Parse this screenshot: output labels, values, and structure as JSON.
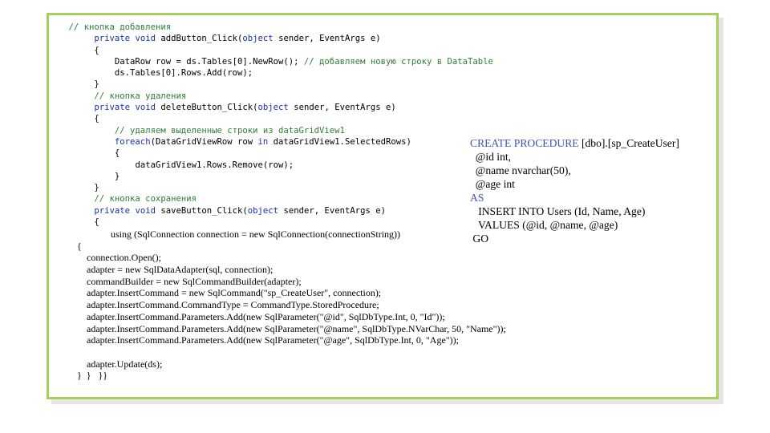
{
  "code_lines": [
    {
      "indent": "    ",
      "parts": [
        {
          "t": "// кнопка добавления",
          "c": "comment"
        }
      ]
    },
    {
      "indent": "         ",
      "parts": [
        {
          "t": "private",
          "c": "kw"
        },
        {
          "t": " ",
          "c": ""
        },
        {
          "t": "void",
          "c": "kw"
        },
        {
          "t": " addButton_Click(",
          "c": ""
        },
        {
          "t": "object",
          "c": "kw"
        },
        {
          "t": " sender, EventArgs e)",
          "c": ""
        }
      ]
    },
    {
      "indent": "         ",
      "parts": [
        {
          "t": "{",
          "c": ""
        }
      ]
    },
    {
      "indent": "             ",
      "parts": [
        {
          "t": "DataRow row = ds.Tables[0].NewRow(); ",
          "c": ""
        },
        {
          "t": "// добавляем новую строку в DataTable",
          "c": "comment"
        }
      ]
    },
    {
      "indent": "             ",
      "parts": [
        {
          "t": "ds.Tables[0].Rows.Add(row);",
          "c": ""
        }
      ]
    },
    {
      "indent": "         ",
      "parts": [
        {
          "t": "}",
          "c": ""
        }
      ]
    },
    {
      "indent": "         ",
      "parts": [
        {
          "t": "// кнопка удаления",
          "c": "comment"
        }
      ]
    },
    {
      "indent": "         ",
      "parts": [
        {
          "t": "private",
          "c": "kw"
        },
        {
          "t": " ",
          "c": ""
        },
        {
          "t": "void",
          "c": "kw"
        },
        {
          "t": " deleteButton_Click(",
          "c": ""
        },
        {
          "t": "object",
          "c": "kw"
        },
        {
          "t": " sender, EventArgs e)",
          "c": ""
        }
      ]
    },
    {
      "indent": "         ",
      "parts": [
        {
          "t": "{",
          "c": ""
        }
      ]
    },
    {
      "indent": "             ",
      "parts": [
        {
          "t": "// удаляем выделенные строки из dataGridView1",
          "c": "comment"
        }
      ]
    },
    {
      "indent": "             ",
      "parts": [
        {
          "t": "foreach",
          "c": "kw"
        },
        {
          "t": "(DataGridViewRow row ",
          "c": ""
        },
        {
          "t": "in",
          "c": "kw"
        },
        {
          "t": " dataGridView1.SelectedRows)",
          "c": ""
        }
      ]
    },
    {
      "indent": "             ",
      "parts": [
        {
          "t": "{",
          "c": ""
        }
      ]
    },
    {
      "indent": "                 ",
      "parts": [
        {
          "t": "dataGridView1.Rows.Remove(row);",
          "c": ""
        }
      ]
    },
    {
      "indent": "             ",
      "parts": [
        {
          "t": "}",
          "c": ""
        }
      ]
    },
    {
      "indent": "         ",
      "parts": [
        {
          "t": "}",
          "c": ""
        }
      ]
    },
    {
      "indent": "         ",
      "parts": [
        {
          "t": "// кнопка сохранения",
          "c": "comment"
        }
      ]
    },
    {
      "indent": "         ",
      "parts": [
        {
          "t": "private",
          "c": "kw"
        },
        {
          "t": " ",
          "c": ""
        },
        {
          "t": "void",
          "c": "kw"
        },
        {
          "t": " saveButton_Click(",
          "c": ""
        },
        {
          "t": "object",
          "c": "kw"
        },
        {
          "t": " sender, EventArgs e)",
          "c": ""
        }
      ]
    },
    {
      "indent": "         ",
      "parts": [
        {
          "t": "{",
          "c": ""
        }
      ]
    }
  ],
  "serif_lines": [
    "              using (SqlConnection connection = new SqlConnection(connectionString))",
    "{",
    "    connection.Open();",
    "    adapter = new SqlDataAdapter(sql, connection);",
    "    commandBuilder = new SqlCommandBuilder(adapter);",
    "    adapter.InsertCommand = new SqlCommand(\"sp_CreateUser\", connection);",
    "    adapter.InsertCommand.CommandType = CommandType.StoredProcedure;",
    "    adapter.InsertCommand.Parameters.Add(new SqlParameter(\"@id\", SqlDbType.Int, 0, \"Id\"));",
    "    adapter.InsertCommand.Parameters.Add(new SqlParameter(\"@name\", SqlDbType.NVarChar, 50, \"Name\"));",
    "    adapter.InsertCommand.Parameters.Add(new SqlParameter(\"@age\", SqlDbType.Int, 0, \"Age\"));",
    "",
    "    adapter.Update(ds);",
    "}  }   }}"
  ],
  "sql_lines": [
    {
      "accent": "CREATE PROCEDURE",
      "rest": " [dbo].[sp_CreateUser]"
    },
    {
      "accent": "",
      "rest": "  @id int,"
    },
    {
      "accent": "",
      "rest": "  @name nvarchar(50),"
    },
    {
      "accent": "",
      "rest": "  @age int"
    },
    {
      "accent": "AS",
      "rest": ""
    },
    {
      "accent": "",
      "rest": "   INSERT INTO Users (Id, Name, Age)"
    },
    {
      "accent": "",
      "rest": "   VALUES (@id, @name, @age)"
    },
    {
      "accent": "",
      "rest": " GO"
    }
  ],
  "colors": {
    "frame_border": "#a9cf5a",
    "comment": "#2e7d32",
    "keyword": "#1b2fb5",
    "sql_accent": "#3d55b2"
  }
}
